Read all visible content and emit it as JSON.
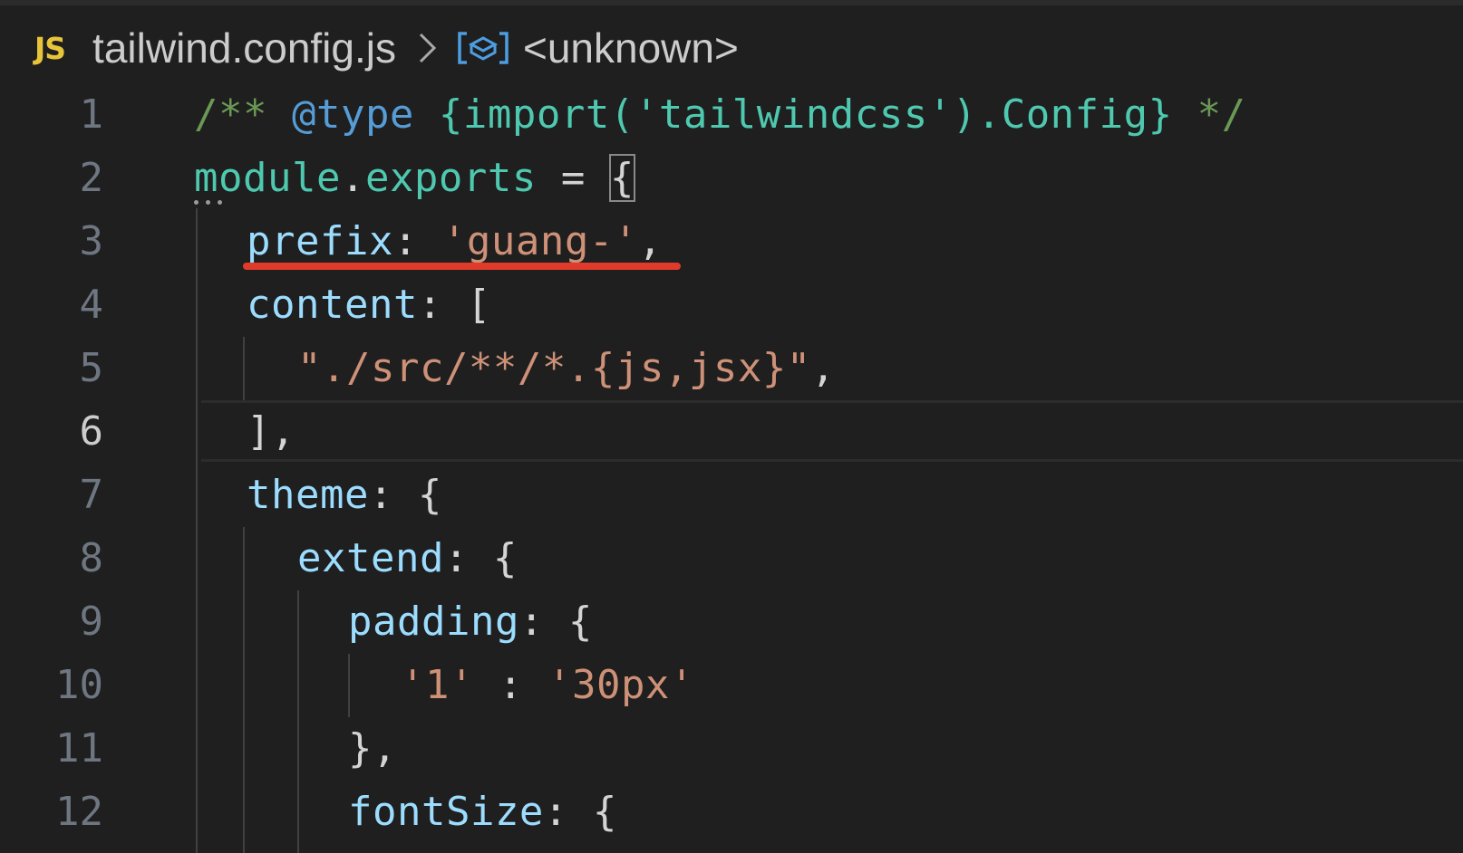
{
  "breadcrumb": {
    "badge": "JS",
    "file": "tailwind.config.js",
    "symbol": "<unknown>"
  },
  "editor": {
    "active_line": 6,
    "lines": [
      {
        "number": "1",
        "tokens": [
          {
            "t": "/** ",
            "c": "cmt"
          },
          {
            "t": "@type",
            "c": "kw"
          },
          {
            "t": " ",
            "c": "p"
          },
          {
            "t": "{import('tailwindcss').Config}",
            "c": "ty"
          },
          {
            "t": " */",
            "c": "cmt"
          }
        ]
      },
      {
        "number": "2",
        "tokens": [
          {
            "t": "module",
            "c": "ty"
          },
          {
            "t": ".",
            "c": "p"
          },
          {
            "t": "exports",
            "c": "ty"
          },
          {
            "t": " = ",
            "c": "p"
          },
          {
            "t": "{",
            "c": "p",
            "hl": true
          }
        ]
      },
      {
        "number": "3",
        "tokens": [
          {
            "t": "prefix",
            "c": "prop"
          },
          {
            "t": ": ",
            "c": "p"
          },
          {
            "t": "'guang-'",
            "c": "str"
          },
          {
            "t": ",",
            "c": "p"
          }
        ]
      },
      {
        "number": "4",
        "tokens": [
          {
            "t": "content",
            "c": "prop"
          },
          {
            "t": ": [",
            "c": "p"
          }
        ]
      },
      {
        "number": "5",
        "tokens": [
          {
            "t": "\"./src/**/*.{js,jsx}\"",
            "c": "str"
          },
          {
            "t": ",",
            "c": "p"
          }
        ]
      },
      {
        "number": "6",
        "tokens": [
          {
            "t": "],",
            "c": "p"
          }
        ]
      },
      {
        "number": "7",
        "tokens": [
          {
            "t": "theme",
            "c": "prop"
          },
          {
            "t": ": {",
            "c": "p"
          }
        ]
      },
      {
        "number": "8",
        "tokens": [
          {
            "t": "extend",
            "c": "prop"
          },
          {
            "t": ": {",
            "c": "p"
          }
        ]
      },
      {
        "number": "9",
        "tokens": [
          {
            "t": "padding",
            "c": "prop"
          },
          {
            "t": ": {",
            "c": "p"
          }
        ]
      },
      {
        "number": "10",
        "tokens": [
          {
            "t": "'1'",
            "c": "str"
          },
          {
            "t": " : ",
            "c": "p"
          },
          {
            "t": "'30px'",
            "c": "str"
          }
        ]
      },
      {
        "number": "11",
        "tokens": [
          {
            "t": "},",
            "c": "p"
          }
        ]
      },
      {
        "number": "12",
        "tokens": [
          {
            "t": "fontSize",
            "c": "prop"
          },
          {
            "t": ": {",
            "c": "p"
          }
        ]
      }
    ]
  },
  "colors": {
    "background": "#1f1f1f",
    "comment": "#6a9955",
    "keyword": "#569cd6",
    "type": "#4ec9b0",
    "property": "#9cdcfe",
    "string": "#ce9178",
    "js_badge": "#e8c43a",
    "annotation_underline": "#e03a2b"
  },
  "icons": [
    "chevron-right-icon",
    "symbol-brackets-icon"
  ]
}
